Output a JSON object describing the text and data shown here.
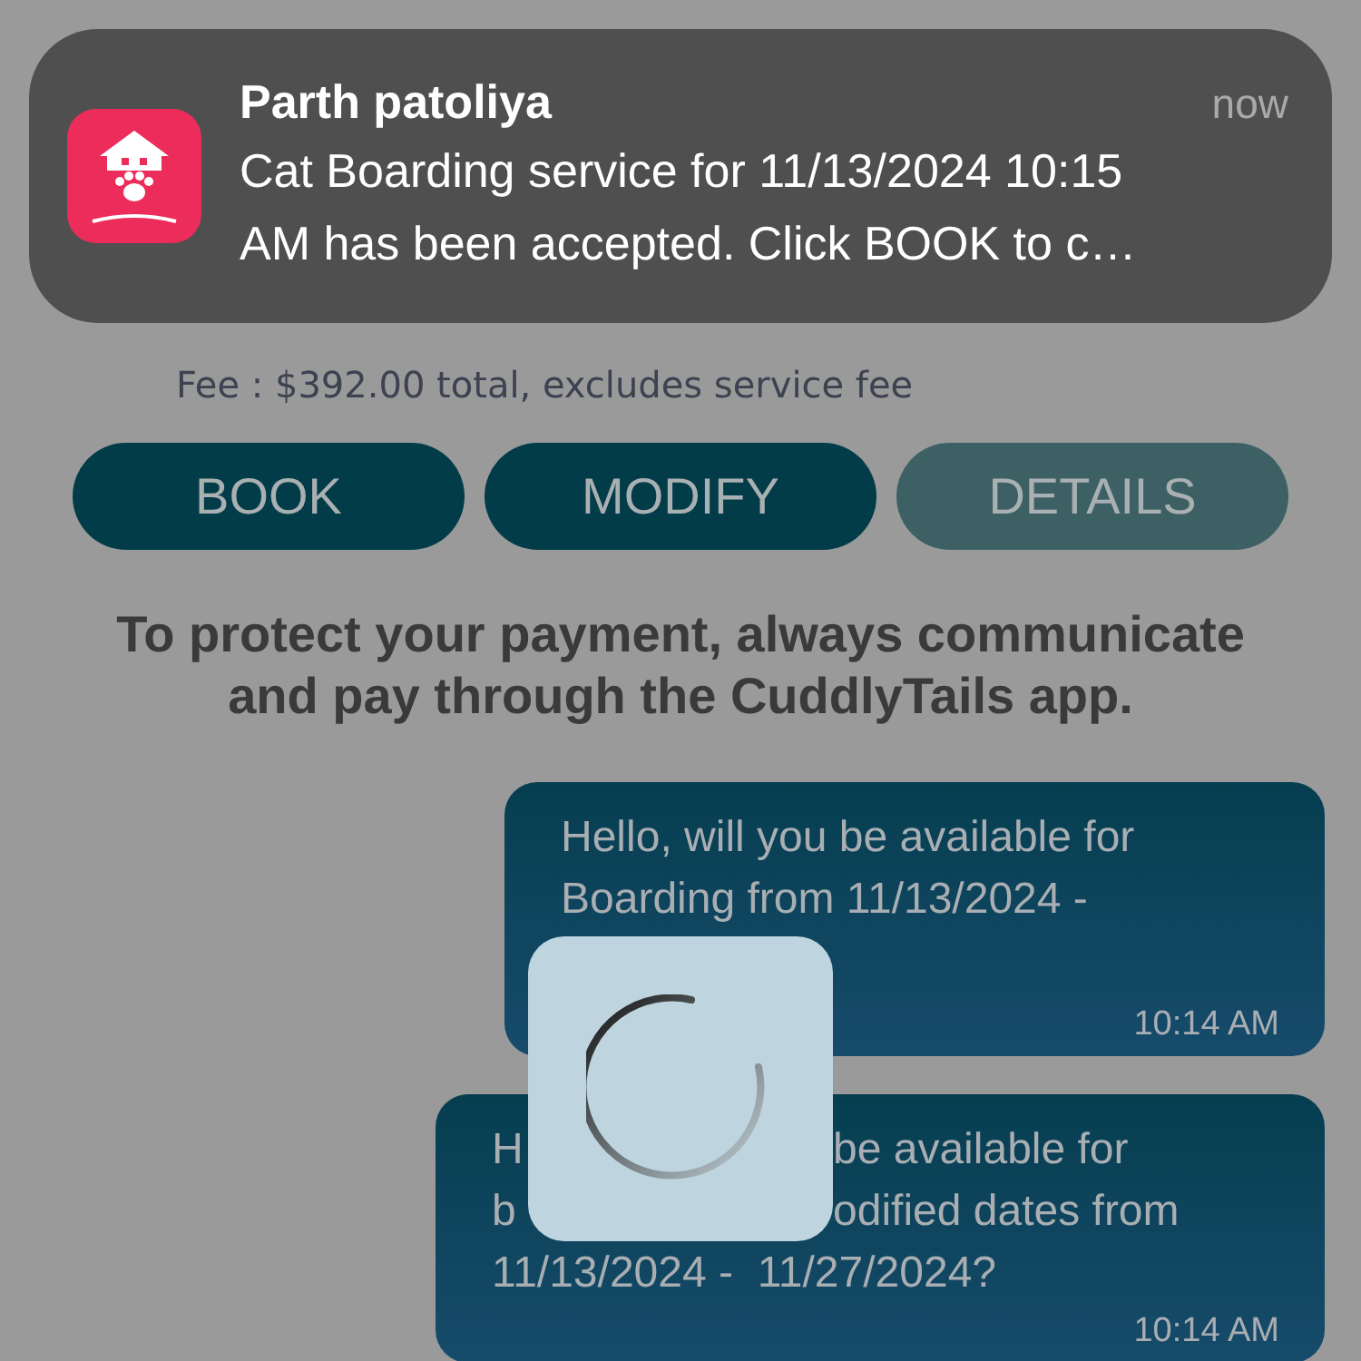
{
  "notification": {
    "sender": "Parth patoliya",
    "time": "now",
    "body": "Cat Boarding service for 11/13/2024 10:15 AM has been accepted. Click BOOK to c…"
  },
  "booking": {
    "fee": "Fee : $392.00 total, excludes service fee",
    "actions": [
      {
        "label": "BOOK",
        "disabled": false
      },
      {
        "label": "MODIFY",
        "disabled": false
      },
      {
        "label": "DETAILS",
        "disabled": true
      }
    ]
  },
  "notice": "To protect your payment, always communicate and pay through the CuddlyTails app.",
  "messages": [
    {
      "text": "Hello, will you be available for Boarding from 11/13/2024 -",
      "time": "10:14 AM"
    },
    {
      "lines": [
        [
          "H",
          "be available for"
        ],
        [
          "b",
          "odified dates from"
        ],
        [
          "11/13/2024 -  11/27/2024?"
        ]
      ],
      "time": "10:14 AM"
    }
  ],
  "loading": true
}
